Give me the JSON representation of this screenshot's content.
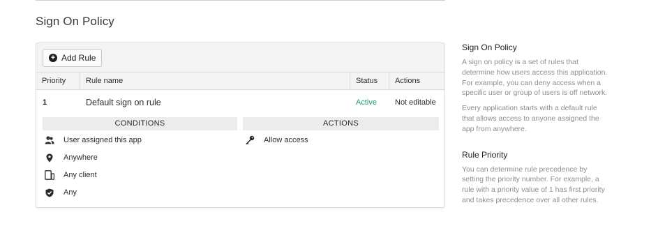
{
  "page": {
    "title": "Sign On Policy"
  },
  "toolbar": {
    "add_rule_label": "Add Rule"
  },
  "table": {
    "columns": [
      "Priority",
      "Rule name",
      "Status",
      "Actions"
    ],
    "rows": [
      {
        "priority": "1",
        "name": "Default sign on rule",
        "status": "Active",
        "actions": "Not editable"
      }
    ]
  },
  "rule_detail": {
    "conditions_header": "CONDITIONS",
    "actions_header": "ACTIONS",
    "conditions": [
      {
        "icon": "user-group-icon",
        "label": "User assigned this app"
      },
      {
        "icon": "location-pin-icon",
        "label": "Anywhere"
      },
      {
        "icon": "devices-icon",
        "label": "Any client"
      },
      {
        "icon": "shield-check-icon",
        "label": "Any"
      }
    ],
    "actions": [
      {
        "icon": "key-icon",
        "label": "Allow access"
      }
    ]
  },
  "sidebar": {
    "section1_title": "Sign On Policy",
    "section1_p1": "A sign on policy is a set of rules that determine how users access this application. For example, you can deny access when a specific user or group of users is off network.",
    "section1_p2": "Every application starts with a default rule that allows access to anyone assigned the app from anywhere.",
    "section2_title": "Rule Priority",
    "section2_p1": "You can determine rule precedence by setting the priority number. For example, a rule with a priority value of 1 has first priority and takes precedence over all other rules."
  },
  "colors": {
    "status_active": "#1a9a66",
    "muted_text": "#8e8e93",
    "header_bg": "#f4f4f4"
  }
}
